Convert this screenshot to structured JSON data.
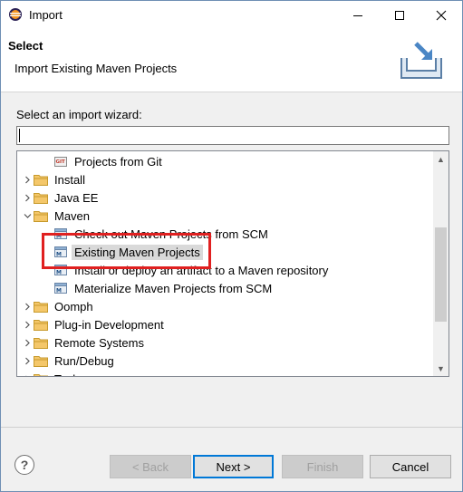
{
  "window": {
    "title": "Import",
    "min_icon": "minimize-icon",
    "max_icon": "maximize-icon",
    "close_icon": "close-icon"
  },
  "banner": {
    "title": "Select",
    "description": "Import Existing Maven Projects",
    "icon": "import-wizard-icon"
  },
  "filter": {
    "label": "Select an import wizard:",
    "value": ""
  },
  "tree": {
    "items": [
      {
        "label": "Projects from Git",
        "kind": "file",
        "icon": "git-icon",
        "level": 2
      },
      {
        "label": "Install",
        "kind": "folder",
        "expanded": false,
        "level": 1
      },
      {
        "label": "Java EE",
        "kind": "folder",
        "expanded": false,
        "level": 1
      },
      {
        "label": "Maven",
        "kind": "folder",
        "expanded": true,
        "level": 1
      },
      {
        "label": "Check out Maven Projects from SCM",
        "kind": "file",
        "icon": "maven-icon",
        "level": 2
      },
      {
        "label": "Existing Maven Projects",
        "kind": "file",
        "icon": "maven-icon",
        "level": 2,
        "selected": true
      },
      {
        "label": "Install or deploy an artifact to a Maven repository",
        "kind": "file",
        "icon": "maven-icon",
        "level": 2
      },
      {
        "label": "Materialize Maven Projects from SCM",
        "kind": "file",
        "icon": "maven-icon",
        "level": 2
      },
      {
        "label": "Oomph",
        "kind": "folder",
        "expanded": false,
        "level": 1
      },
      {
        "label": "Plug-in Development",
        "kind": "folder",
        "expanded": false,
        "level": 1
      },
      {
        "label": "Remote Systems",
        "kind": "folder",
        "expanded": false,
        "level": 1
      },
      {
        "label": "Run/Debug",
        "kind": "folder",
        "expanded": false,
        "level": 1
      },
      {
        "label": "Tasks",
        "kind": "folder",
        "expanded": false,
        "level": 1
      }
    ]
  },
  "buttons": {
    "help": "?",
    "back": "< Back",
    "next": "Next >",
    "finish": "Finish",
    "cancel": "Cancel"
  },
  "colors": {
    "highlight": "#e02020",
    "default_button_border": "#0078d7",
    "selection": "#d9d9d9"
  }
}
